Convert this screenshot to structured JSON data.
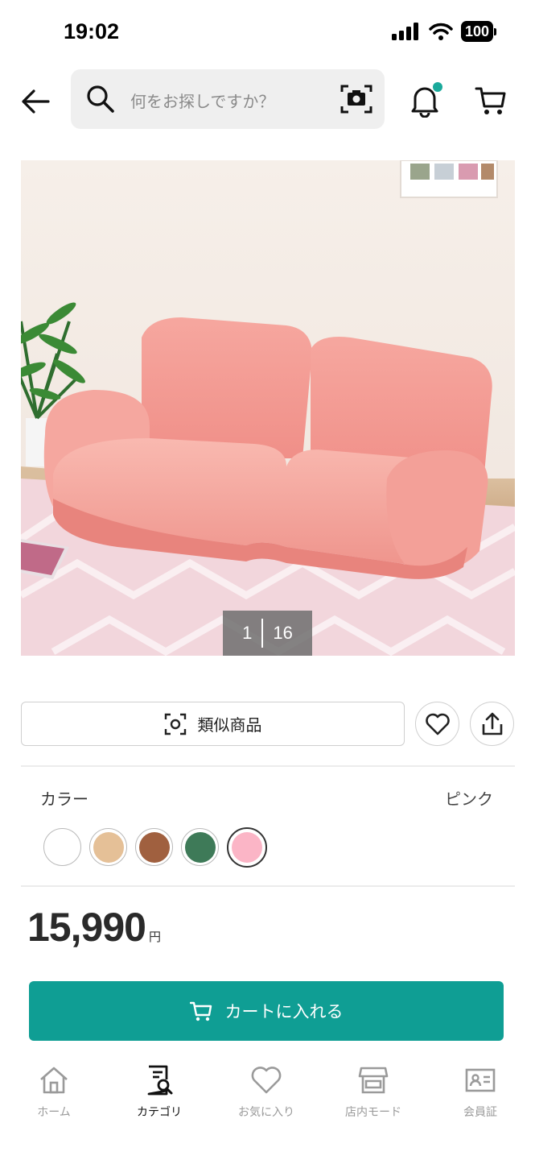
{
  "status_bar": {
    "time": "19:02",
    "battery": "100"
  },
  "header": {
    "search_placeholder": "何をお探しですか？"
  },
  "product": {
    "image_counter": {
      "current": "1",
      "total": "16"
    },
    "similar_button_label": "類似商品",
    "color": {
      "label": "カラー",
      "selected_value": "ピンク",
      "swatches": [
        "#ffffff",
        "#e5c097",
        "#a0603f",
        "#3e7a58",
        "#fbb5c6"
      ],
      "selected_index": 4
    },
    "price": {
      "value": "15,990",
      "unit": "円"
    },
    "add_to_cart_label": "カートに入れる"
  },
  "bottom_nav": {
    "items": [
      {
        "label": "ホーム",
        "icon": "home-icon"
      },
      {
        "label": "カテゴリ",
        "icon": "category-icon"
      },
      {
        "label": "お気に入り",
        "icon": "heart-icon"
      },
      {
        "label": "店内モード",
        "icon": "store-icon"
      },
      {
        "label": "会員証",
        "icon": "member-card-icon"
      }
    ],
    "active_index": 1
  },
  "colors": {
    "accent": "#0f9e94",
    "notification_dot": "#1aa99b"
  }
}
